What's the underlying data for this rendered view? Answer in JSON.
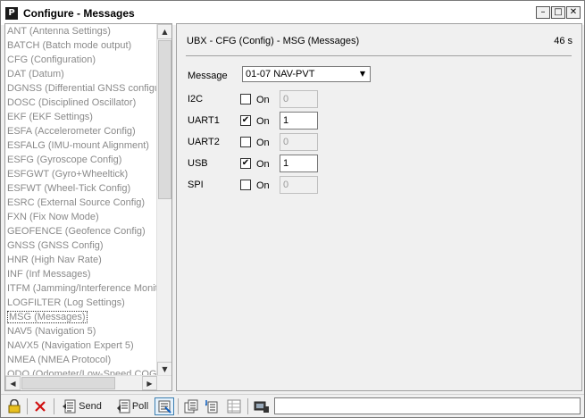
{
  "window": {
    "title": "Configure - Messages",
    "icon": "P",
    "controls": {
      "minimize": "–",
      "maximize": "□",
      "close": "✕"
    }
  },
  "message_list": {
    "items": [
      "ANT (Antenna Settings)",
      "BATCH (Batch mode output)",
      "CFG (Configuration)",
      "DAT (Datum)",
      "DGNSS (Differential GNSS configuration)",
      "DOSC (Disciplined Oscillator)",
      "EKF (EKF Settings)",
      "ESFA (Accelerometer Config)",
      "ESFALG (IMU-mount Alignment)",
      "ESFG (Gyroscope Config)",
      "ESFGWT (Gyro+Wheeltick)",
      "ESFWT (Wheel-Tick Config)",
      "ESRC (External Source Config)",
      "FXN (Fix Now Mode)",
      "GEOFENCE (Geofence Config)",
      "GNSS (GNSS Config)",
      "HNR (High Nav Rate)",
      "INF (Inf Messages)",
      "ITFM (Jamming/Interference Monitor)",
      "LOGFILTER (Log Settings)",
      "MSG (Messages)",
      "NAV5 (Navigation 5)",
      "NAVX5 (Navigation Expert 5)",
      "NMEA (NMEA Protocol)",
      "ODO (Odometer/Low-Speed COG Filter)"
    ],
    "selected_index": 20
  },
  "panel": {
    "title": "UBX - CFG (Config) - MSG (Messages)",
    "timer": "46 s",
    "message_label": "Message",
    "message_value": "01-07 NAV-PVT",
    "on_label": "On",
    "ports": [
      {
        "name": "I2C",
        "checked": false,
        "rate": "0",
        "enabled": false
      },
      {
        "name": "UART1",
        "checked": true,
        "rate": "1",
        "enabled": true
      },
      {
        "name": "UART2",
        "checked": false,
        "rate": "0",
        "enabled": false
      },
      {
        "name": "USB",
        "checked": true,
        "rate": "1",
        "enabled": true
      },
      {
        "name": "SPI",
        "checked": false,
        "rate": "0",
        "enabled": false
      }
    ]
  },
  "toolbar": {
    "lock_icon": "lock-icon",
    "send_label": "Send",
    "poll_label": "Poll"
  },
  "scroll": {
    "up": "▲",
    "down": "▼",
    "left": "◀",
    "right": "▶"
  }
}
